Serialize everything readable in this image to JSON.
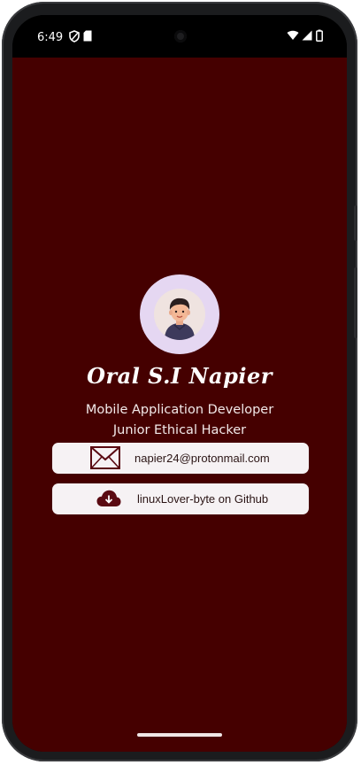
{
  "status_bar": {
    "time": "6:49",
    "icons": [
      "vpn-shield-icon",
      "sim-card-icon",
      "wifi-icon",
      "signal-icon",
      "battery-icon"
    ]
  },
  "profile": {
    "avatar": "avatar-icon",
    "name": "Oral S.I Napier",
    "title_line1": "Mobile Application Developer",
    "title_line2": "Junior Ethical Hacker"
  },
  "contacts": {
    "email": {
      "icon": "mail-icon",
      "text": "napier24@protonmail.com"
    },
    "github": {
      "icon": "cloud-download-icon",
      "text": "linuxLover-byte on Github"
    }
  },
  "colors": {
    "background": "#450000",
    "card": "#f6f2f4",
    "avatar_ring": "#e5d7f2",
    "icon": "#5a0a12"
  }
}
